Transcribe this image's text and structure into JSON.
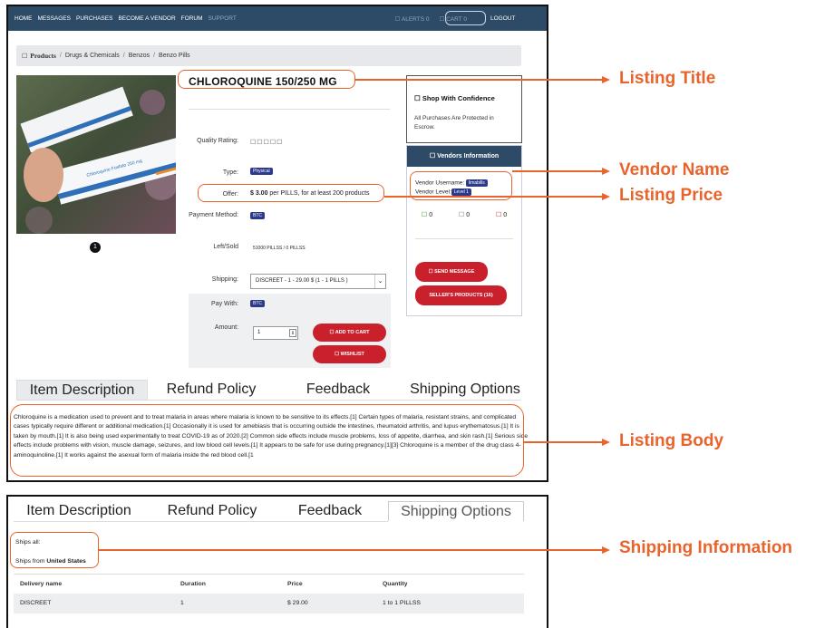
{
  "nav": {
    "items": [
      "HOME",
      "MESSAGES",
      "PURCHASES",
      "BECOME A VENDOR",
      "FORUM"
    ],
    "support": "SUPPORT",
    "alerts": "☐ ALERTS 0",
    "cart": "☐ CART 0",
    "logout": "LOGOUT"
  },
  "breadcrumb": {
    "root": "Products",
    "path": [
      "Drugs & Chemicals",
      "Benzos",
      "Benzo Pills"
    ]
  },
  "listing": {
    "title": "CHLOROQUINE 150/250 MG",
    "image_caption": "Chloroquine Fosfato 250 mg",
    "image_index": "1",
    "quality_label": "Quality Rating:",
    "stars": "☐☐☐☐☐",
    "type_label": "Type:",
    "type_value": "Physical",
    "offer_label": "Offer:",
    "offer_price": "$ 3.00",
    "offer_rest": " per PILLS, for at least 200 products",
    "payment_label": "Payment Method:",
    "payment_value": "BTC",
    "leftsold_label": "Left/Sold",
    "leftsold_value": "51000 PILLSS / 0 PILLSS",
    "shipping_label": "Shipping:",
    "shipping_value": "DISCREET - 1 - 29.00 $ (1 - 1 PILLS )",
    "paywith_label": "Pay With:",
    "paywith_value": "BTC",
    "amount_label": "Amount:",
    "amount_value": "1",
    "add_to_cart": "☐ ADD TO CART",
    "wishlist": "☐ WISHLIST"
  },
  "shop": {
    "title": "Shop With Confidence",
    "text": "All Purchases Are Protected in Escrow."
  },
  "vendor": {
    "header": "Vendors Information",
    "username_label": "Vendor Username:",
    "username": "limabills",
    "level_label": "Vendor Level:",
    "level": "Level 1",
    "positive": "0",
    "neutral": "0",
    "negative": "0",
    "send_message": "☐ SEND MESSAGE",
    "products": "SELLER'S PRODUCTS (16)"
  },
  "tabs": [
    "Item Description",
    "Refund Policy",
    "Feedback",
    "Shipping Options"
  ],
  "description": "Chloroquine is a medication used to prevent and to treat malaria in areas where malaria is known to be sensitive to its effects.[1] Certain types of malaria, resistant strains, and complicated cases typically require different or additional medication.[1] Occasionally it is used for amebiasis that is occurring outside the intestines, rheumatoid arthritis, and lupus erythematosus.[1] It is taken by mouth.[1] It is also being used experimentally to treat COVID-19 as of 2020.[2] Common side effects include muscle problems, loss of appetite, diarrhea, and skin rash.[1] Serious side effects include problems with vision, muscle damage, seizures, and low blood cell levels.[1] It appears to be safe for use during pregnancy.[1][3] Chloroquine is a member of the drug class 4-aminoquinoline.[1] It works against the asexual form of malaria inside the red blood cell.[1",
  "shipping": {
    "ships_all": "Ships all:",
    "ships_from_label": "Ships from",
    "ships_from_value": "United States",
    "columns": [
      "Delivery name",
      "Duration",
      "Price",
      "Quantity"
    ],
    "row": [
      "DISCREET",
      "1",
      "$ 29.00",
      "1 to 1 PILLSS"
    ]
  },
  "annotations": {
    "listing_title": "Listing Title",
    "vendor_name": "Vendor Name",
    "listing_price": "Listing Price",
    "listing_body": "Listing Body",
    "shipping_information": "Shipping Information"
  },
  "colors": {
    "navbar": "#2d4a67",
    "annotation": "#e8642c",
    "button_red": "#c9202c",
    "badge_blue": "#2b3a8b"
  }
}
